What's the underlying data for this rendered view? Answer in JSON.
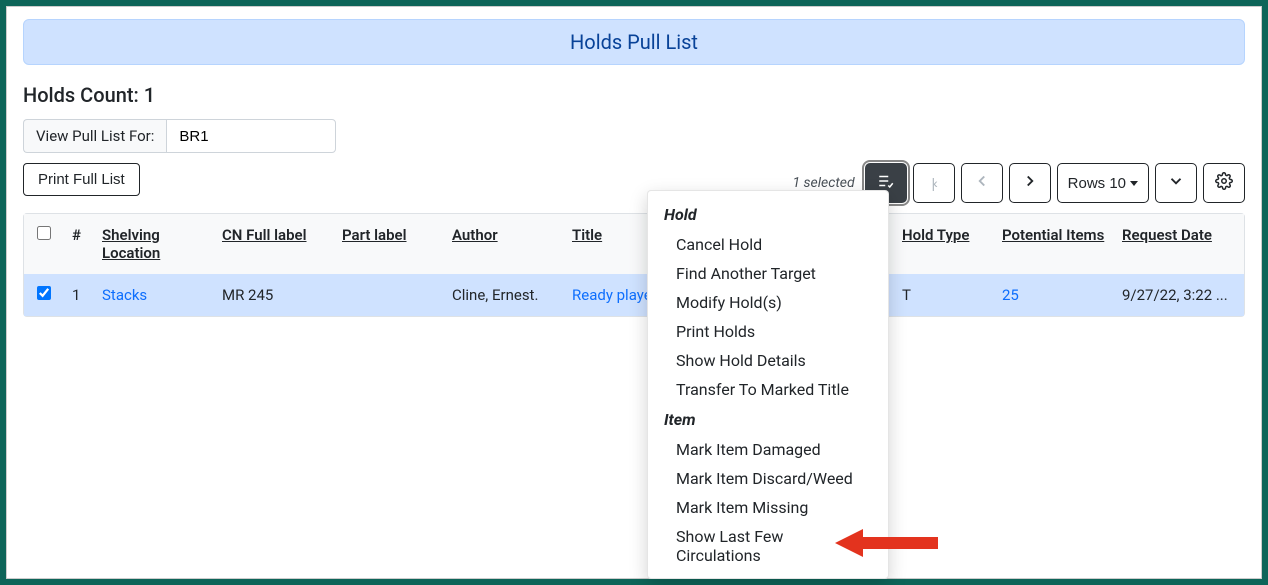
{
  "banner": {
    "title": "Holds Pull List"
  },
  "holds_count_label": "Holds Count: 1",
  "pull_list_for": {
    "label": "View Pull List For:",
    "value": "BR1"
  },
  "print_button_label": "Print Full List",
  "pagination": {
    "selected_text": "1 selected",
    "rows_label": "Rows 10"
  },
  "table": {
    "headers": {
      "num": "#",
      "shelving_location": "Shelving Location",
      "cn_full_label": "CN Full label",
      "part_label": "Part label",
      "author": "Author",
      "title": "Title",
      "hold_type": "Hold Type",
      "potential_items": "Potential Items",
      "request_date": "Request Date"
    },
    "rows": [
      {
        "num": "1",
        "shelving_location": "Stacks",
        "cn_full_label": "MR 245",
        "part_label": "",
        "author": "Cline, Ernest.",
        "title": "Ready player",
        "hold_type": "T",
        "potential_items": "25",
        "request_date": "9/27/22, 3:22 ..."
      }
    ]
  },
  "dropdown": {
    "hold_heading": "Hold",
    "item_heading": "Item",
    "hold_items": {
      "cancel": "Cancel Hold",
      "find_target": "Find Another Target",
      "modify": "Modify Hold(s)",
      "print": "Print Holds",
      "details": "Show Hold Details",
      "transfer": "Transfer To Marked Title"
    },
    "item_items": {
      "damaged": "Mark Item Damaged",
      "discard": "Mark Item Discard/Weed",
      "missing": "Mark Item Missing",
      "circulations": "Show Last Few Circulations"
    }
  }
}
